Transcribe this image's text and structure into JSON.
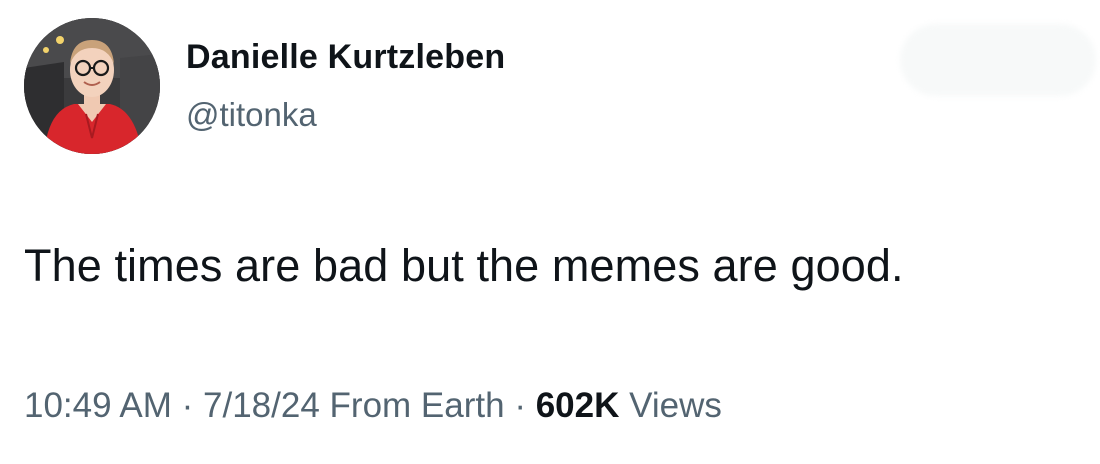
{
  "tweet": {
    "author": {
      "display_name": "Danielle Kurtzleben",
      "handle": "@titonka",
      "avatar_icon": "profile-photo"
    },
    "text": "The times are bad but the memes are good.",
    "meta": {
      "time": "10:49 AM",
      "separator": "·",
      "date": "7/18/24",
      "location": "From Earth",
      "views_count": "602K",
      "views_label": "Views"
    }
  },
  "colors": {
    "text_primary": "#0f1419",
    "text_secondary": "#536471",
    "background": "#ffffff"
  }
}
